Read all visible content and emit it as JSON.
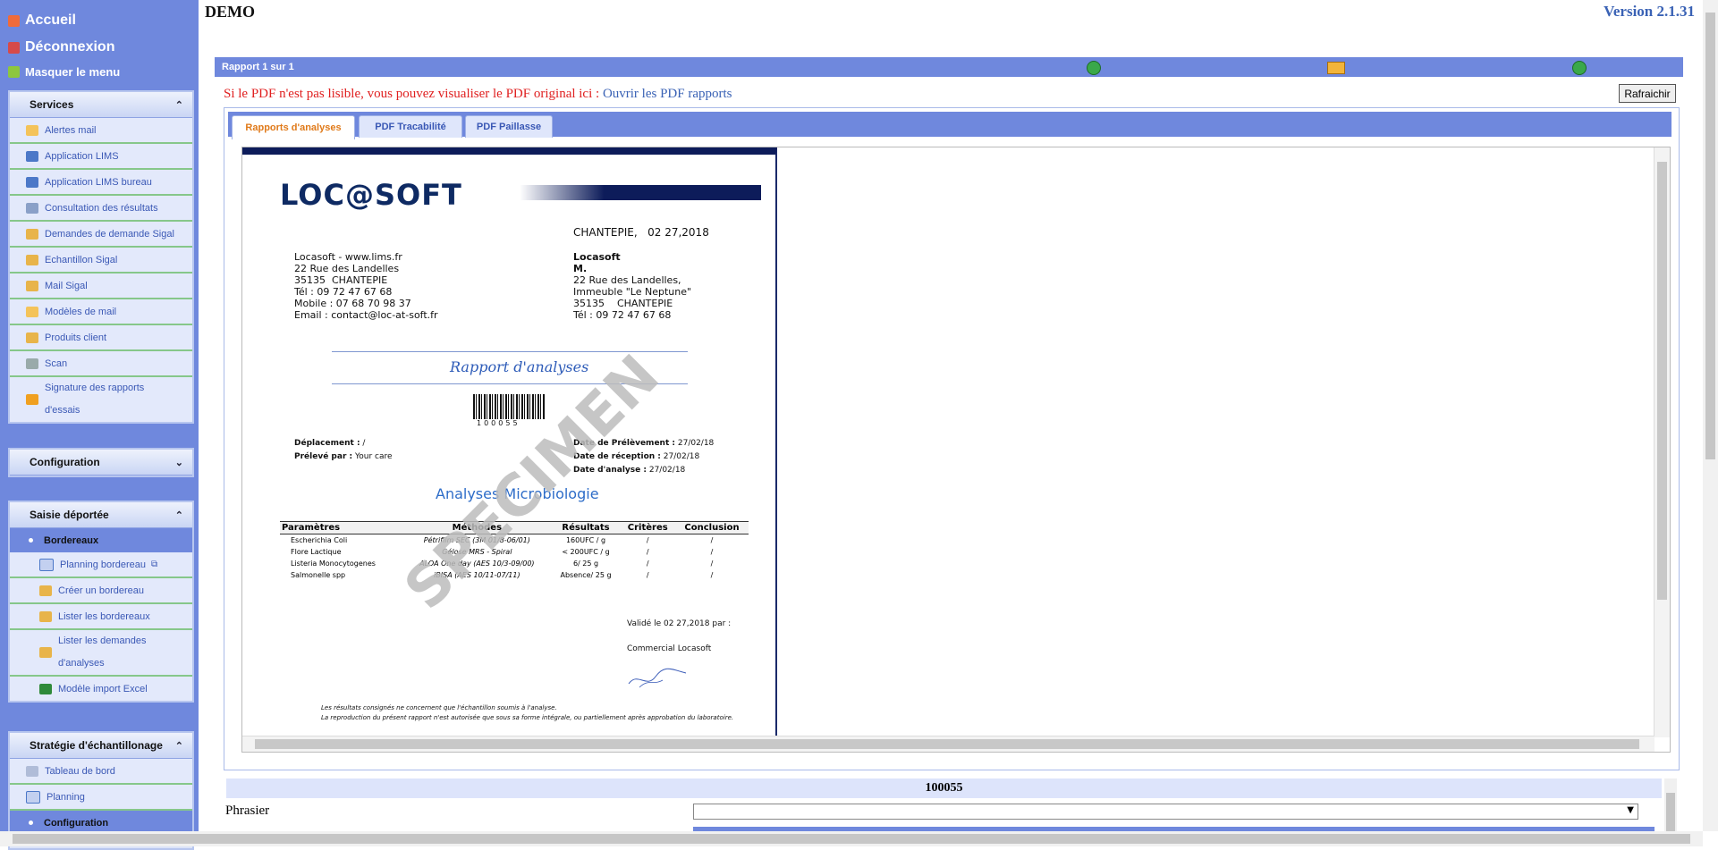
{
  "sidebar": {
    "top_links": [
      {
        "label": "Accueil",
        "icon": "home-icon"
      },
      {
        "label": "Déconnexion",
        "icon": "logout-icon"
      },
      {
        "label": "Masquer le menu",
        "icon": "hide-menu-icon"
      }
    ],
    "services": {
      "title": "Services",
      "items": [
        "Alertes mail",
        "Application LIMS",
        "Application LIMS bureau",
        "Consultation des résultats",
        "Demandes de demande Sigal",
        "Echantillon Sigal",
        "Mail Sigal",
        "Modèles de mail",
        "Produits client",
        "Scan",
        "Signature des rapports d'essais"
      ]
    },
    "configuration": {
      "title": "Configuration"
    },
    "saisie": {
      "title": "Saisie déportée",
      "active": "Bordereaux",
      "items": [
        "Planning bordereau",
        "Créer un bordereau",
        "Lister les bordereaux",
        "Lister les demandes d'analyses",
        "Modèle import Excel"
      ]
    },
    "strategie": {
      "title": "Stratégie d'échantillonage",
      "items": [
        "Tableau de bord",
        "Planning"
      ],
      "active": "Configuration"
    }
  },
  "header": {
    "title": "DEMO",
    "version": "Version 2.1.31"
  },
  "report": {
    "counter": "Rapport 1 sur 1",
    "notice_text": "Si le PDF n'est pas lisible, vous pouvez visualiser le PDF original ici : ",
    "notice_link": "Ouvrir les PDF rapports",
    "refresh_label": "Rafraichir",
    "tabs": [
      "Rapports d'analyses",
      "PDF Tracabilité",
      "PDF Paillasse"
    ]
  },
  "pdf": {
    "logo": "LOC@SOFT",
    "date_line": "CHANTEPIE,   02 27,2018",
    "sender": [
      "Locasoft - www.lims.fr",
      "22 Rue des Landelles",
      "35135  CHANTEPIE",
      "Tél : 09 72 47 67 68",
      "Mobile : 07 68 70 98 37",
      "Email : contact@loc-at-soft.fr"
    ],
    "recipient_name": "Locasoft",
    "recipient_title": "M.",
    "recipient": [
      "22 Rue des Landelles,",
      "Immeuble \"Le Neptune\"",
      "35135    CHANTEPIE",
      "Tél : 09 72 47 67 68"
    ],
    "report_title": "Rapport d'analyses",
    "barcode_number": "100055",
    "deplacement_label": "Déplacement :",
    "deplacement_value": " /",
    "preleve_label": "Prélevé par :",
    "preleve_value": " Your care",
    "date_prelevement_label": "Date de Prélèvement :",
    "date_prelevement_value": " 27/02/18",
    "date_reception_label": "Date de réception :",
    "date_reception_value": " 27/02/18",
    "date_analyse_label": "Date d'analyse :",
    "date_analyse_value": " 27/02/18",
    "section_title": "Analyses Microbiologie",
    "table_headers": [
      "Paramètres",
      "Méthodes",
      "Résultats",
      "Critères",
      "Conclusion"
    ],
    "table_rows": [
      [
        "Escherichia Coli",
        "Pétrifilm SEC (3M 01/8-06/01)",
        "160UFC / g",
        "/",
        "/"
      ],
      [
        "Flore Lactique",
        "Gélose MRS - Spiral",
        "< 200UFC / g",
        "/",
        "/"
      ],
      [
        "Listeria Monocytogenes",
        "ALOA One day (AES 10/3-09/00)",
        "6/ 25 g",
        "/",
        "/"
      ],
      [
        "Salmonelle spp",
        "iBISA (AES 10/11-07/11)",
        "Absence/ 25 g",
        "/",
        "/"
      ]
    ],
    "validation": "Validé le 02 27,2018 par :",
    "validator": "Commercial Locasoft",
    "footnote_1": "Les résultats consignés ne concernent que l'échantillon soumis à l'analyse.",
    "footnote_2": "La reproduction du présent rapport n'est autorisée que sous sa forme intégrale, ou partiellement après approbation du laboratoire.",
    "watermark": "SPECIMEN"
  },
  "sample": {
    "id": "100055",
    "phrasier_label": "Phrasier",
    "phrasier_value": ""
  }
}
